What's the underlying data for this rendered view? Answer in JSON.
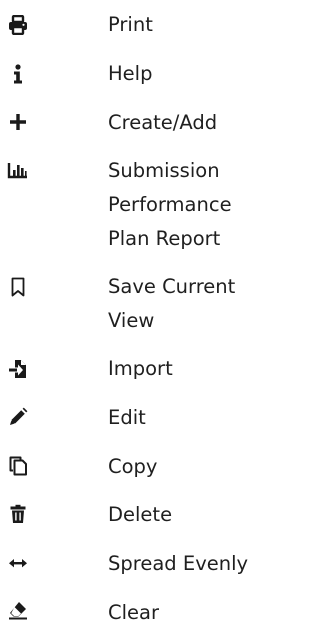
{
  "legend": {
    "items": [
      {
        "icon": "print-icon",
        "label": "Print"
      },
      {
        "icon": "info-icon",
        "label": "Help"
      },
      {
        "icon": "plus-icon",
        "label": "Create/Add"
      },
      {
        "icon": "bar-chart-icon",
        "label": "Submission\nPerformance\nPlan Report"
      },
      {
        "icon": "bookmark-icon",
        "label": "Save Current\nView"
      },
      {
        "icon": "import-icon",
        "label": "Import"
      },
      {
        "icon": "pencil-icon",
        "label": "Edit"
      },
      {
        "icon": "copy-icon",
        "label": "Copy"
      },
      {
        "icon": "trash-icon",
        "label": "Delete"
      },
      {
        "icon": "arrows-horizontal-icon",
        "label": "Spread Evenly"
      },
      {
        "icon": "eraser-icon",
        "label": "Clear"
      }
    ]
  }
}
